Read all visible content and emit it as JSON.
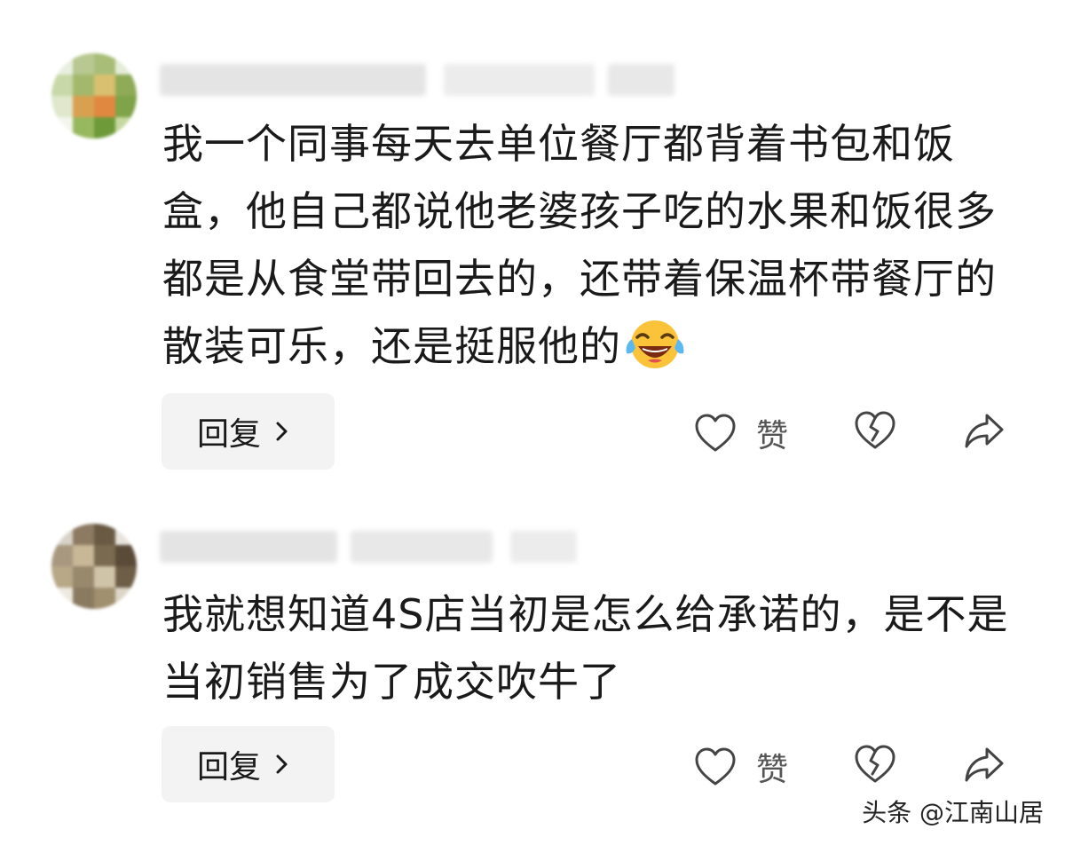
{
  "comments": [
    {
      "text": "我一个同事每天去单位餐厅都背着书包和饭盒，他自己都说他老婆孩子吃的水果和饭很多都是从食堂带回去的，还带着保温杯带餐厅的散装可乐，还是挺服他的",
      "emoji": "laughing-with-tears",
      "reply_label": "回复",
      "like_label": "赞"
    },
    {
      "text": "我就想知道4S店当初是怎么给承诺的，是不是当初销售为了成交吹牛了",
      "reply_label": "回复",
      "like_label": "赞"
    }
  ],
  "icons": {
    "like": "heart-outline-icon",
    "dislike": "broken-heart-icon",
    "share": "share-arrow-icon",
    "reply_chevron": "chevron-right-icon"
  },
  "watermark": "头条 @江南山居",
  "colors": {
    "text": "#1a1a1a",
    "button_bg": "#f3f3f3",
    "icon": "#444444"
  }
}
